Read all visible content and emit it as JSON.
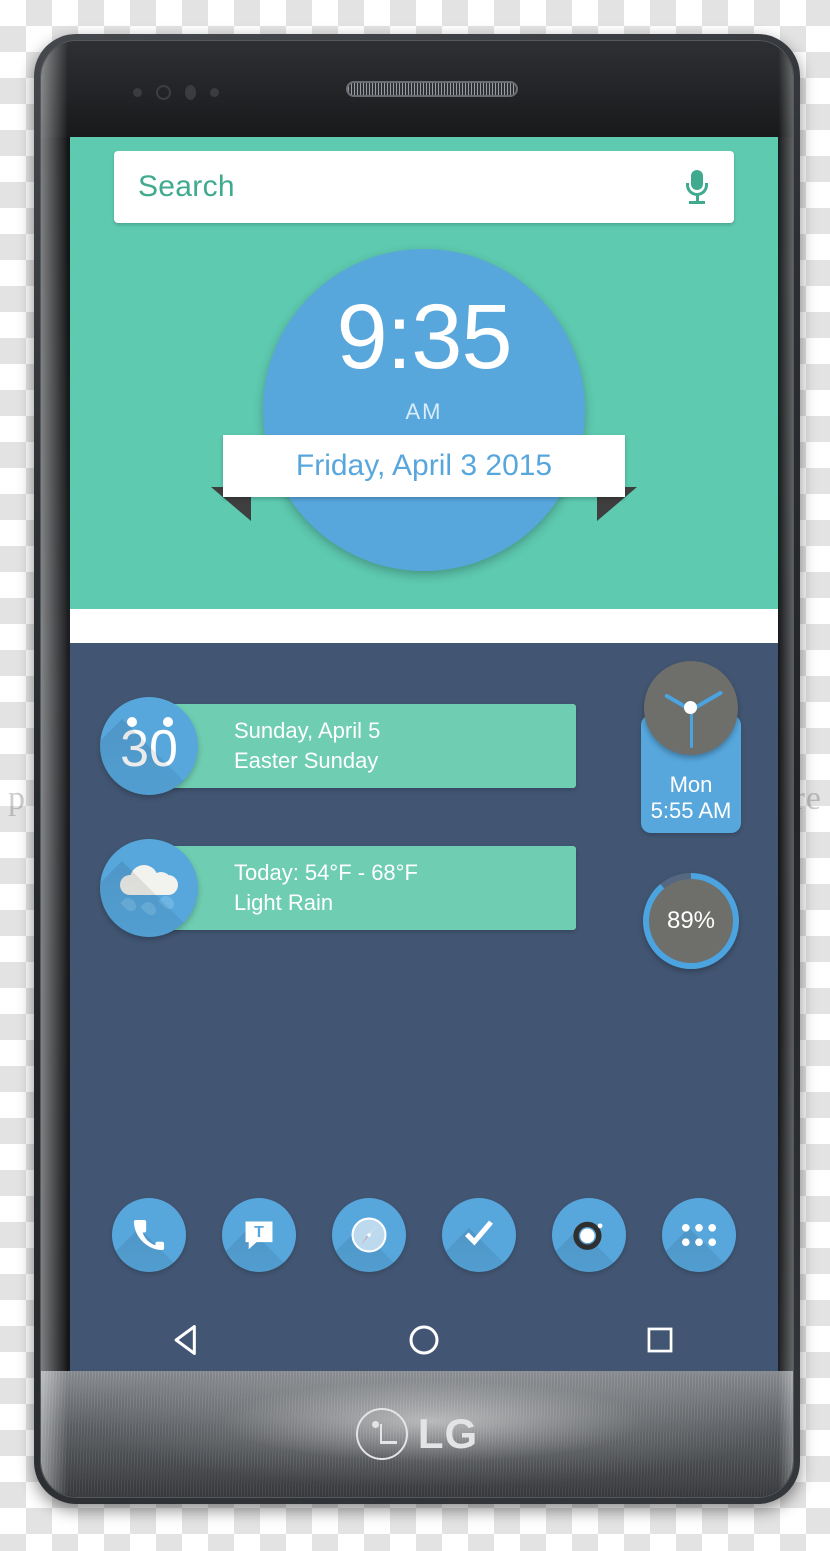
{
  "device": {
    "brand": "LG",
    "earpiece_label": "earpiece-speaker"
  },
  "screen": {
    "search": {
      "placeholder": "Search",
      "mic_icon": "microphone-icon"
    },
    "clock_widget": {
      "time": "9:35",
      "ampm": "AM",
      "date": "Friday, April 3 2015"
    },
    "info_cards": [
      {
        "icon": "calendar-icon",
        "badge_number": "30",
        "line1": "Sunday, April 5",
        "line2": "Easter Sunday"
      },
      {
        "icon": "rain-cloud-icon",
        "line1": "Today: 54°F - 68°F",
        "line2": "Light Rain"
      }
    ],
    "alarm_widget": {
      "icon": "analog-clock-icon",
      "day": "Mon",
      "time": "5:55 AM"
    },
    "battery_widget": {
      "icon": "battery-ring-icon",
      "percent_label": "89%",
      "percent_value": 89
    },
    "dock": [
      {
        "name": "phone-icon",
        "label": "Phone"
      },
      {
        "name": "messaging-icon",
        "label": "Messaging"
      },
      {
        "name": "browser-compass-icon",
        "label": "Browser"
      },
      {
        "name": "tasks-check-icon",
        "label": "Tasks"
      },
      {
        "name": "camera-icon",
        "label": "Camera"
      },
      {
        "name": "app-drawer-icon",
        "label": "Apps"
      }
    ],
    "navbar": [
      {
        "name": "back-button",
        "label": "Back"
      },
      {
        "name": "home-button",
        "label": "Home"
      },
      {
        "name": "recents-button",
        "label": "Recents"
      }
    ]
  },
  "watermark": {
    "left": "p",
    "right": "re"
  },
  "colors": {
    "teal": "#5ecab0",
    "card_teal": "#6fcdb1",
    "blue": "#57a7dd",
    "slate": "#425673",
    "white": "#ffffff",
    "grey": "#6e6e6b"
  }
}
